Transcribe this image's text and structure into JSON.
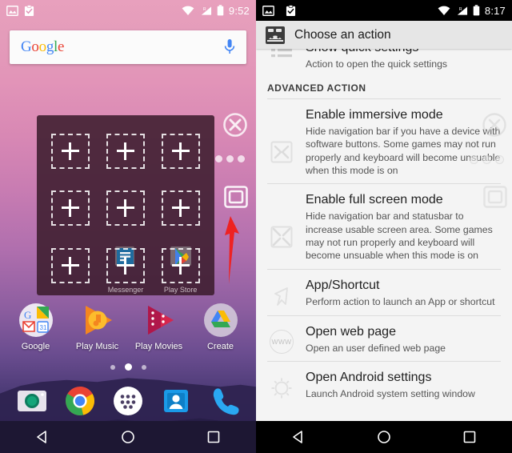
{
  "left_phone": {
    "statusbar": {
      "icons": [
        "image-icon",
        "clipboard-check-icon"
      ],
      "right_icons": [
        "wifi-icon",
        "signal-icon",
        "battery-icon"
      ],
      "time": "9:52",
      "signal_label": "R"
    },
    "search": {
      "logo_letters": [
        "G",
        "o",
        "o",
        "g",
        "l",
        "e"
      ],
      "mic_icon": "microphone-icon"
    },
    "overlay_panel": {
      "cells": [
        {
          "type": "empty",
          "label": ""
        },
        {
          "type": "empty",
          "label": ""
        },
        {
          "type": "empty",
          "label": ""
        },
        {
          "type": "empty",
          "label": ""
        },
        {
          "type": "empty",
          "label": ""
        },
        {
          "type": "empty",
          "label": ""
        },
        {
          "type": "empty",
          "label": ""
        },
        {
          "type": "app",
          "label": "Messenger",
          "icon": "messenger-icon"
        },
        {
          "type": "app",
          "label": "Play Store",
          "icon": "play-store-icon"
        }
      ]
    },
    "floating_controls": {
      "close_icon": "close-x-circle-icon",
      "dots_icon": "more-dots-icon",
      "square_icon": "rounded-square-icon",
      "pointer_icon": "red-arrow-pointer"
    },
    "app_row": [
      {
        "label": "Google",
        "icon": "google-folder-icon"
      },
      {
        "label": "Play Music",
        "icon": "play-music-icon"
      },
      {
        "label": "Play Movies",
        "icon": "play-movies-icon"
      },
      {
        "label": "Create",
        "icon": "create-folder-icon"
      }
    ],
    "page_dots": {
      "count": 3,
      "active_index": 1
    },
    "dock": [
      {
        "icon": "camera-icon"
      },
      {
        "icon": "chrome-icon"
      },
      {
        "icon": "app-drawer-icon"
      },
      {
        "icon": "contacts-icon"
      },
      {
        "icon": "phone-icon"
      }
    ],
    "navbar": [
      {
        "icon": "back-triangle-icon"
      },
      {
        "icon": "home-circle-icon"
      },
      {
        "icon": "recents-square-icon"
      }
    ]
  },
  "right_phone": {
    "statusbar": {
      "icons": [
        "image-icon",
        "clipboard-check-icon"
      ],
      "right_icons": [
        "wifi-icon",
        "signal-icon",
        "battery-icon"
      ],
      "time": "8:17",
      "signal_label": "R"
    },
    "appbar": {
      "app_icon": "robot-app-icon",
      "title": "Choose an action"
    },
    "clipped_row": {
      "icon": "list-lines-icon",
      "title": "Show quick settings",
      "sub": "Action to open the quick settings"
    },
    "section_header": "ADVANCED ACTION",
    "items": [
      {
        "icon": "immersive-mode-icon",
        "title": "Enable immersive mode",
        "sub": "Hide navigation bar if you have a device with software buttons. Some games may not run properly and keyboard will become unsuable when this mode is on"
      },
      {
        "icon": "full-screen-mode-icon",
        "title": "Enable full screen mode",
        "sub": "Hide navigation bar and statusbar to increase usable screen area. Some games may not run properly and keyboard will become unsuable when this mode is on"
      },
      {
        "icon": "cursor-arrow-icon",
        "title": "App/Shortcut",
        "sub": "Perform action to launch an App or shortcut"
      },
      {
        "icon": "www-globe-icon",
        "title": "Open web page",
        "sub": "Open an user defined web page"
      },
      {
        "icon": "gear-icon",
        "title": "Open Android settings",
        "sub": "Launch Android system setting window"
      }
    ],
    "www_label": "WWW",
    "floating_controls": {
      "close_icon": "close-x-circle-icon",
      "dots_icon": "more-dots-icon",
      "square_icon": "rounded-square-icon"
    },
    "navbar": [
      {
        "icon": "back-triangle-icon"
      },
      {
        "icon": "home-circle-icon"
      },
      {
        "icon": "recents-square-icon"
      }
    ]
  }
}
